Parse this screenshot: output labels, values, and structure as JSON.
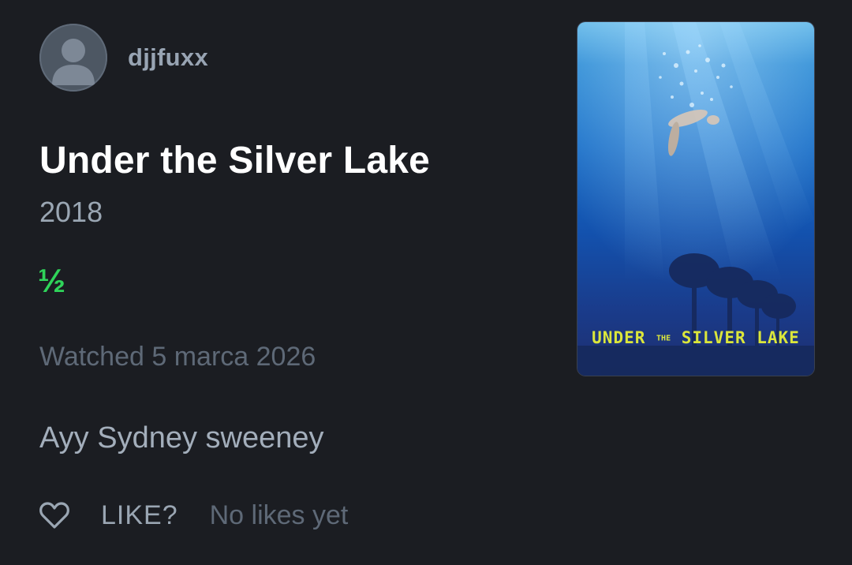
{
  "user": {
    "username": "djjfuxx",
    "avatar_icon": "person-silhouette-icon"
  },
  "film": {
    "title": "Under the Silver Lake",
    "year": "2018",
    "rating": "½",
    "rating_value": 0.5,
    "rating_max": 5,
    "watched": "Watched 5 marca 2026",
    "review": "Ayy Sydney sweeney"
  },
  "poster": {
    "title_part1": "UNDER",
    "title_part2": "THE",
    "title_part3": "SILVER LAKE"
  },
  "like": {
    "icon": "heart-outline-icon",
    "label": "LIKE?",
    "count_text": "No likes yet"
  },
  "colors": {
    "background": "#1b1d22",
    "rating_green": "#2fd45a",
    "poster_title_yellow": "#dbe63b"
  }
}
